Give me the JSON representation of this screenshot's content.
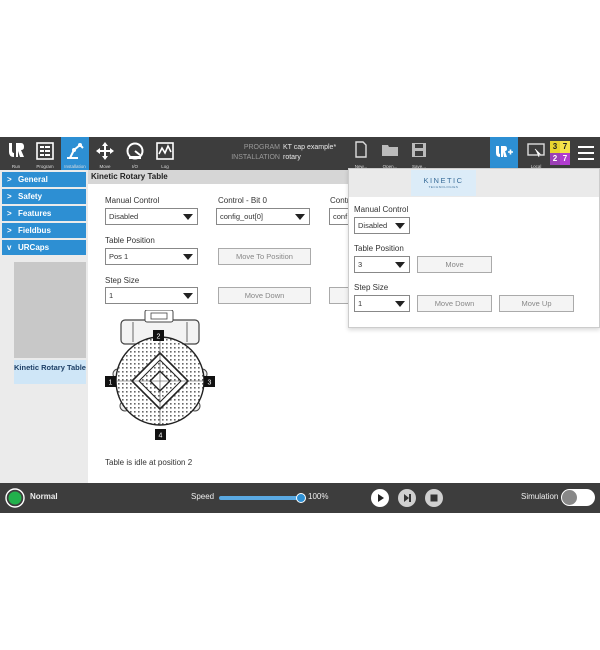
{
  "topbar": {
    "nav": [
      {
        "label": "Run",
        "icon": "ur-logo-icon"
      },
      {
        "label": "Program",
        "icon": "program-icon"
      },
      {
        "label": "Installation",
        "icon": "installation-icon"
      },
      {
        "label": "Move",
        "icon": "move-icon"
      },
      {
        "label": "I/O",
        "icon": "io-icon"
      },
      {
        "label": "Log",
        "icon": "log-icon"
      }
    ],
    "program_key": "PROGRAM",
    "program_value": "KT cap example*",
    "installation_key": "INSTALLATION",
    "installation_value": "rotary",
    "file_actions": [
      {
        "label": "New...",
        "icon": "new-file-icon"
      },
      {
        "label": "Open...",
        "icon": "open-folder-icon"
      },
      {
        "label": "Save...",
        "icon": "save-icon"
      }
    ],
    "local_label": "Local",
    "counter": [
      "3",
      "7",
      "2",
      "7"
    ],
    "counter_colors": [
      "#e8d32f",
      "#f4e24a",
      "#9b3fb5",
      "#b13ccf"
    ]
  },
  "sidebar": {
    "items": [
      {
        "label": "General",
        "chevron": ">"
      },
      {
        "label": "Safety",
        "chevron": ">"
      },
      {
        "label": "Features",
        "chevron": ">"
      },
      {
        "label": "Fieldbus",
        "chevron": ">"
      },
      {
        "label": "URCaps",
        "chevron": "v"
      }
    ],
    "sub_item": "Kinetic Rotary Table"
  },
  "main": {
    "title": "Kinetic Rotary Table",
    "manual_control_label": "Manual Control",
    "manual_control_value": "Disabled",
    "control_bit0_label": "Control - Bit 0",
    "control_bit0_value": "config_out[0]",
    "control_bit1_label": "Contr",
    "control_bit1_value": "conf",
    "table_position_label": "Table Position",
    "table_position_value": "Pos 1",
    "move_to_position_label": "Move To Position",
    "step_size_label": "Step Size",
    "step_size_value": "1",
    "move_down_label": "Move Down",
    "markers": [
      "1",
      "2",
      "3",
      "4"
    ],
    "status": "Table is idle at position 2"
  },
  "overlay": {
    "brand": "KINETIC",
    "brand_sub": "TECHNOLOGIES",
    "manual_control_label": "Manual Control",
    "manual_control_value": "Disabled",
    "table_position_label": "Table Position",
    "table_position_value": "3",
    "move_label": "Move",
    "step_size_label": "Step Size",
    "step_size_value": "1",
    "move_down_label": "Move Down",
    "move_up_label": "Move Up"
  },
  "bottombar": {
    "status_label": "Normal",
    "status_color": "#22b14c",
    "speed_label": "Speed",
    "speed_value": "100%",
    "speed_fraction": 1.0,
    "simulation_label": "Simulation",
    "simulation_on": false
  },
  "colors": {
    "accent": "#2d8fd3",
    "bar": "#3d3d3d"
  }
}
